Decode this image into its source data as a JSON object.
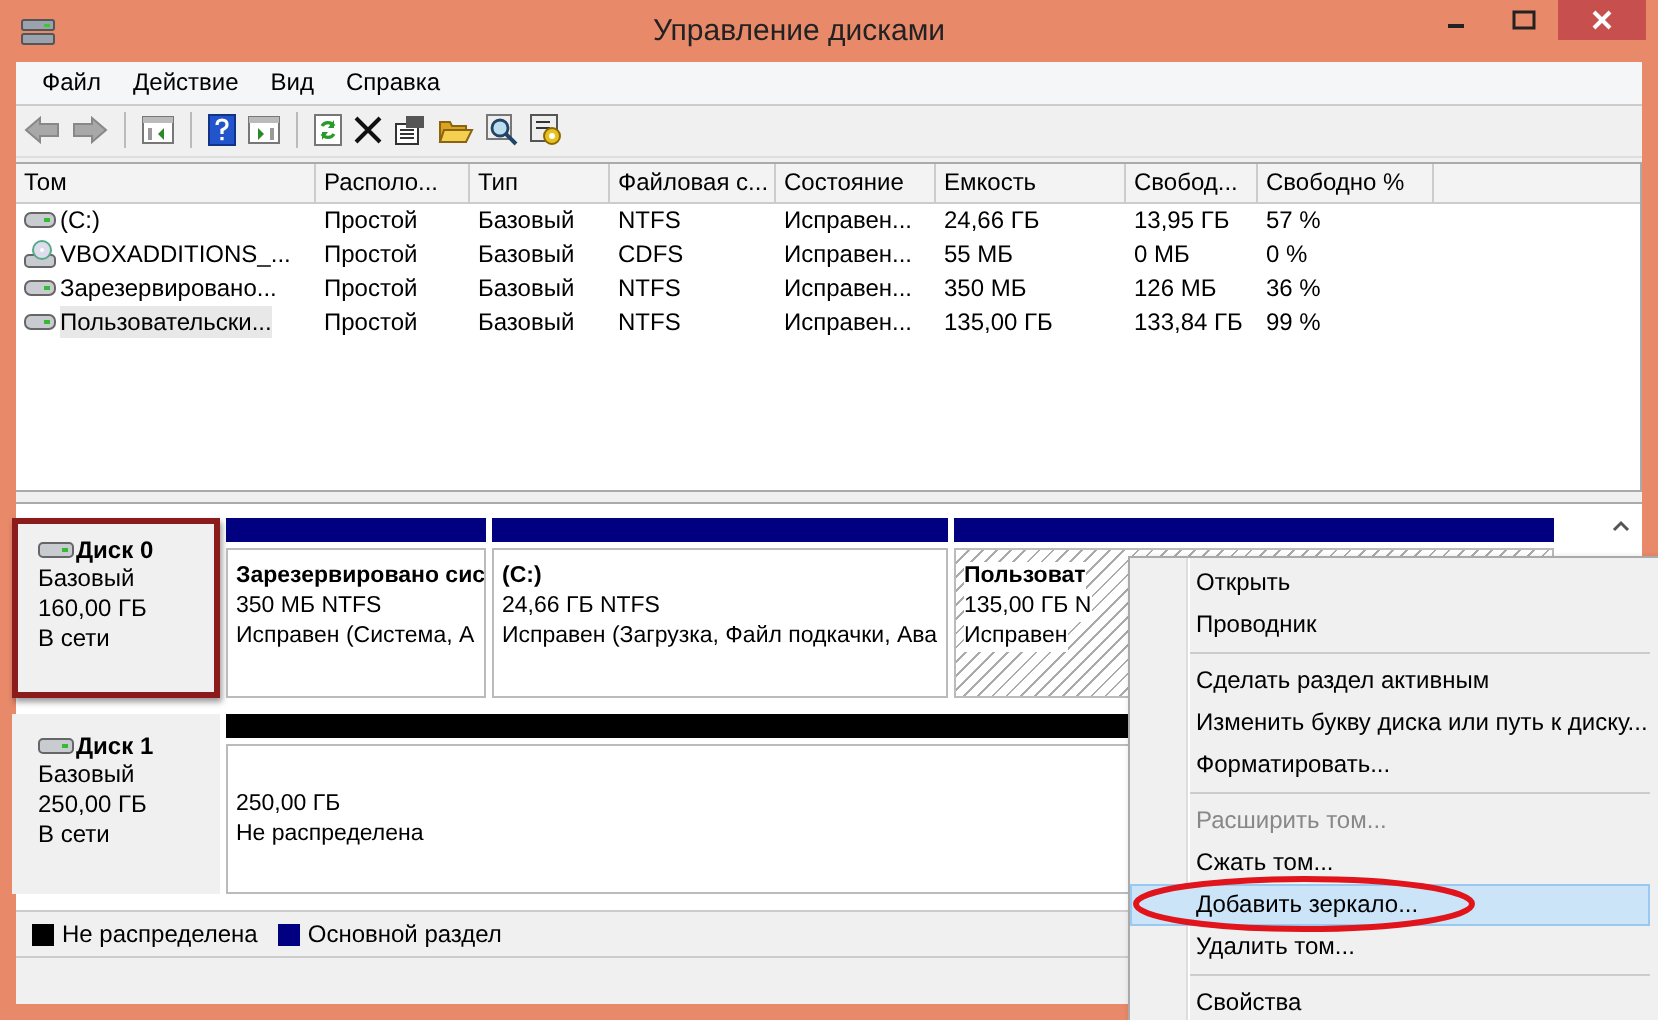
{
  "window": {
    "title": "Управление дисками"
  },
  "menu": [
    "Файл",
    "Действие",
    "Вид",
    "Справка"
  ],
  "volumes": {
    "columns": [
      "Том",
      "Располо...",
      "Тип",
      "Файловая с...",
      "Состояние",
      "Емкость",
      "Свобод...",
      "Свободно %"
    ],
    "rows": [
      {
        "kind": "drive",
        "selected": false,
        "cells": [
          "(C:)",
          "Простой",
          "Базовый",
          "NTFS",
          "Исправен...",
          "24,66 ГБ",
          "13,95 ГБ",
          "57 %"
        ]
      },
      {
        "kind": "cd",
        "selected": false,
        "cells": [
          "VBOXADDITIONS_...",
          "Простой",
          "Базовый",
          "CDFS",
          "Исправен...",
          "55 МБ",
          "0 МБ",
          "0 %"
        ]
      },
      {
        "kind": "drive",
        "selected": false,
        "cells": [
          "Зарезервировано...",
          "Простой",
          "Базовый",
          "NTFS",
          "Исправен...",
          "350 МБ",
          "126 МБ",
          "36 %"
        ]
      },
      {
        "kind": "drive",
        "selected": true,
        "cells": [
          "Пользовательски...",
          "Простой",
          "Базовый",
          "NTFS",
          "Исправен...",
          "135,00 ГБ",
          "133,84 ГБ",
          "99 %"
        ]
      }
    ]
  },
  "disks": [
    {
      "name": "Диск 0",
      "type": "Базовый",
      "size": "160,00 ГБ",
      "status": "В сети",
      "highlighted": true,
      "partitions": [
        {
          "kind": "primary",
          "selected": false,
          "title": "Зарезервировано сис",
          "lines": [
            "350 МБ NTFS",
            "Исправен (Система, А"
          ]
        },
        {
          "kind": "primary",
          "selected": false,
          "title": "(C:)",
          "lines": [
            "24,66 ГБ NTFS",
            "Исправен (Загрузка, Файл подкачки, Ава"
          ]
        },
        {
          "kind": "primary",
          "selected": true,
          "title": "Пользоват",
          "lines": [
            "135,00 ГБ N",
            "Исправен"
          ]
        }
      ]
    },
    {
      "name": "Диск 1",
      "type": "Базовый",
      "size": "250,00 ГБ",
      "status": "В сети",
      "highlighted": false,
      "partitions": [
        {
          "kind": "unallocated",
          "selected": false,
          "lines": [
            "250,00 ГБ",
            "Не распределена"
          ]
        }
      ]
    }
  ],
  "legend": [
    {
      "label": "Не распределена",
      "color": "#000000"
    },
    {
      "label": "Основной раздел",
      "color": "#000080"
    }
  ],
  "context_menu": [
    [
      {
        "label": "Открыть",
        "disabled": false,
        "selected": false,
        "circled": false
      },
      {
        "label": "Проводник",
        "disabled": false,
        "selected": false,
        "circled": false
      }
    ],
    [
      {
        "label": "Сделать раздел активным",
        "disabled": false,
        "selected": false,
        "circled": false
      },
      {
        "label": "Изменить букву диска или путь к диску...",
        "disabled": false,
        "selected": false,
        "circled": false
      },
      {
        "label": "Форматировать...",
        "disabled": false,
        "selected": false,
        "circled": false
      }
    ],
    [
      {
        "label": "Расширить том...",
        "disabled": true,
        "selected": false,
        "circled": false
      },
      {
        "label": "Сжать том...",
        "disabled": false,
        "selected": false,
        "circled": false
      },
      {
        "label": "Добавить зеркало...",
        "disabled": false,
        "selected": true,
        "circled": true
      },
      {
        "label": "Удалить том...",
        "disabled": false,
        "selected": false,
        "circled": false
      }
    ],
    [
      {
        "label": "Свойства",
        "disabled": false,
        "selected": false,
        "circled": false
      }
    ]
  ]
}
